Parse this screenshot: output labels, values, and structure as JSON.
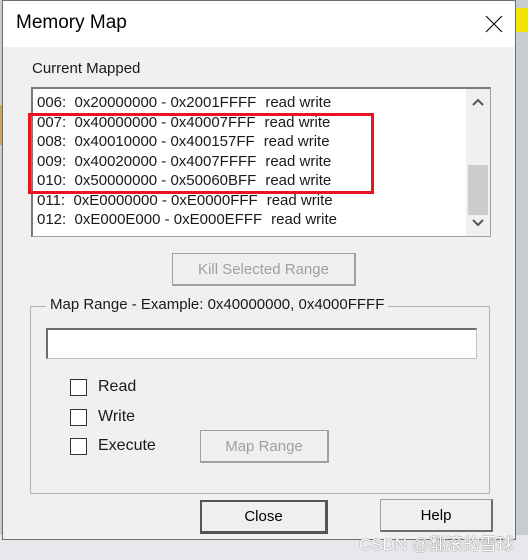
{
  "window": {
    "title": "Memory Map",
    "close_icon": "close-icon"
  },
  "current_mapped": {
    "label": "Current Mapped",
    "items": [
      {
        "index": "006:",
        "range": "0x20000000 - 0x2001FFFF",
        "access": "read write"
      },
      {
        "index": "007:",
        "range": "0x40000000 - 0x40007FFF",
        "access": "read write"
      },
      {
        "index": "008:",
        "range": "0x40010000 - 0x400157FF",
        "access": "read write"
      },
      {
        "index": "009:",
        "range": "0x40020000 - 0x4007FFFF",
        "access": "read write"
      },
      {
        "index": "010:",
        "range": "0x50000000 - 0x50060BFF",
        "access": "read write"
      },
      {
        "index": "011:",
        "range": "0xE0000000 - 0xE0000FFF",
        "access": "read write"
      },
      {
        "index": "012:",
        "range": "0xE000E000 - 0xE000EFFF",
        "access": "read write"
      }
    ],
    "highlight_color": "#e8141f",
    "highlighted_items": [
      "007",
      "008",
      "009",
      "010"
    ]
  },
  "buttons": {
    "kill_selected_range": "Kill Selected Range",
    "map_range": "Map Range",
    "close": "Close",
    "help": "Help"
  },
  "map_range_group": {
    "title": "Map Range - Example:  0x40000000, 0x4000FFFF",
    "input_value": "",
    "checkboxes": [
      {
        "label": "Read",
        "checked": false
      },
      {
        "label": "Write",
        "checked": false
      },
      {
        "label": "Execute",
        "checked": false
      }
    ]
  },
  "watermark": "CSDN @翻滚的雪球"
}
